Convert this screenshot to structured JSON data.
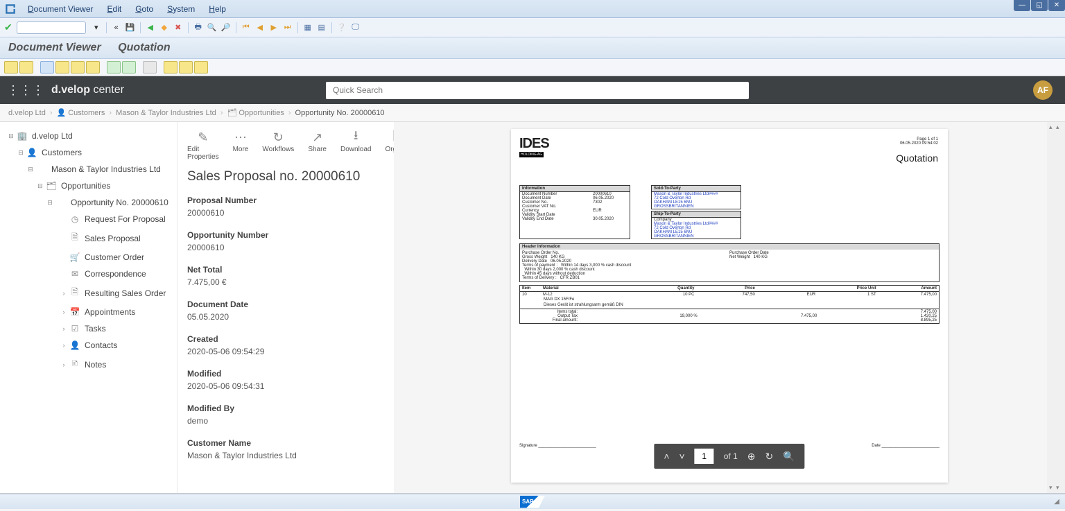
{
  "sap_menu": {
    "items": [
      "Document Viewer",
      "Edit",
      "Goto",
      "System",
      "Help"
    ]
  },
  "title_bar": {
    "left": "Document Viewer",
    "right": "Quotation"
  },
  "dvelop": {
    "brand_prefix": "d.velop",
    "brand_suffix": " center",
    "search_placeholder": "Quick Search",
    "avatar": "AF",
    "grid_apps": "apps"
  },
  "breadcrumb": [
    {
      "label": "d.velop Ltd",
      "icon": ""
    },
    {
      "label": "Customers",
      "icon": "👤"
    },
    {
      "label": "Mason & Taylor Industries Ltd",
      "icon": ""
    },
    {
      "label": "Opportunities",
      "icon": "🗂"
    },
    {
      "label": "Opportunity No. 20000610",
      "icon": ""
    }
  ],
  "tree": [
    {
      "level": 0,
      "label": "d.velop Ltd",
      "expander": "⊟",
      "icon": "building"
    },
    {
      "level": 1,
      "label": "Customers",
      "expander": "⊟",
      "icon": "person"
    },
    {
      "level": 2,
      "label": "Mason & Taylor Industries Ltd",
      "expander": "⊟",
      "icon": ""
    },
    {
      "level": 3,
      "label": "Opportunities",
      "expander": "⊟",
      "icon": "folder"
    },
    {
      "level": 4,
      "label": "Opportunity No. 20000610",
      "expander": "⊟",
      "icon": ""
    },
    {
      "level": 5,
      "label": "Request For Proposal",
      "expander": "",
      "icon": "clock"
    },
    {
      "level": 5,
      "label": "Sales Proposal",
      "expander": "",
      "icon": "doc"
    },
    {
      "level": 5,
      "label": "Customer Order",
      "expander": "",
      "icon": "cart"
    },
    {
      "level": 5,
      "label": "Correspondence",
      "expander": "",
      "icon": "mail"
    },
    {
      "level": 5,
      "label": "Resulting Sales Order",
      "expander": "›",
      "icon": "doc"
    },
    {
      "level": 5,
      "label": "Appointments",
      "expander": "›",
      "icon": "calendar"
    },
    {
      "level": 5,
      "label": "Tasks",
      "expander": "›",
      "icon": "check"
    },
    {
      "level": 5,
      "label": "Contacts",
      "expander": "›",
      "icon": "person"
    },
    {
      "level": 5,
      "label": "Notes",
      "expander": "›",
      "icon": "note"
    }
  ],
  "tools": [
    {
      "label": "Edit Properties",
      "icon": "✎"
    },
    {
      "label": "More",
      "icon": "⋯"
    },
    {
      "label": "Workflows",
      "icon": "↻"
    },
    {
      "label": "Share",
      "icon": "↗"
    },
    {
      "label": "Download",
      "icon": "⭳"
    },
    {
      "label": "Organize",
      "icon": "🗐"
    }
  ],
  "page_title": "Sales Proposal no. 20000610",
  "fields": [
    {
      "label": "Proposal Number",
      "value": "20000610"
    },
    {
      "label": "Opportunity Number",
      "value": "20000610"
    },
    {
      "label": "Net Total",
      "value": "7.475,00 €"
    },
    {
      "label": "Document Date",
      "value": "05.05.2020"
    },
    {
      "label": "Created",
      "value": "2020-05-06 09:54:29"
    },
    {
      "label": "Modified",
      "value": "2020-05-06 09:54:31"
    },
    {
      "label": "Modified By",
      "value": "demo"
    },
    {
      "label": "Customer Name",
      "value": "Mason & Taylor Industries Ltd"
    }
  ],
  "doc": {
    "logo": "IDES",
    "logo_sub": "HOLDING AG",
    "page": "Page 1 of 1",
    "gentime": "06.05.2020 09:54:02",
    "heading": "Quotation",
    "info": {
      "head": "Information",
      "rows": [
        [
          "Document Number",
          "20000610"
        ],
        [
          "Document Date",
          "06.05.2020"
        ],
        [
          "Customer No.",
          "7302"
        ],
        [
          "Customer VAT No.",
          ""
        ],
        [
          "Currency",
          "EUR"
        ],
        [
          "Validity Start Date",
          ""
        ],
        [
          "Validity End Date",
          "30.05.2020"
        ]
      ]
    },
    "soldto": {
      "head": "Sold-To-Party",
      "rows": [
        "Mason & Taylor Industries Ltd####",
        "72 Cold Overton Rd",
        "OAKHAM LE15 6NU",
        "GROSSBRITANNIEN"
      ]
    },
    "shipto": {
      "head": "Ship-To-Party",
      "rows": [
        "Company",
        "Mason & Taylor Industries Ltd####",
        "72 Cold Overton Rd",
        "OAKHAM LE15 6NU",
        "GROSSBRITANNIEN"
      ]
    },
    "header": {
      "head": "Header Information",
      "rows": [
        [
          "Purchase Order No.",
          ""
        ],
        [
          "Purchase Order Date",
          ""
        ],
        [
          "Gross Weight",
          "140  KG"
        ],
        [
          "Net Weight",
          "140  KG"
        ],
        [
          "Delivery Date",
          "06.05.2020"
        ],
        [
          "",
          ""
        ],
        [
          "Terms of payment :",
          "Within 14 days 3,000  % cash discount"
        ],
        [
          "",
          ""
        ],
        [
          "",
          "Within 30 days 2,000  % cash discount"
        ],
        [
          "",
          ""
        ],
        [
          "",
          "Within 45 days without deduction"
        ],
        [
          "",
          ""
        ],
        [
          "Terms of Delivery :",
          "CFR ZB01"
        ],
        [
          "",
          ""
        ]
      ]
    },
    "items_head": [
      "Item",
      "Material",
      "Quantity",
      "Price",
      "",
      "Price Unit",
      "Amount"
    ],
    "items": [
      [
        "10",
        "M-12",
        "10  PC",
        "747,50",
        "EUR",
        "1     ST",
        "7.475,00"
      ]
    ],
    "items_sub": [
      "MAG DX 15F/Fe",
      "Dieses Gerät ist strahlungsarm gemäß DIN"
    ],
    "totals": [
      [
        "Items total:",
        "",
        "",
        "7.475,00"
      ],
      [
        "Output Tax",
        "19,000       %",
        "7.475,00",
        "1.420,25"
      ],
      [
        "Final amount:",
        "",
        "",
        "8.895,25"
      ]
    ],
    "sig_left": "Signature",
    "sig_right": "Date"
  },
  "pdf_nav": {
    "page": "1",
    "of": "of 1"
  },
  "footer": {
    "sap": "SAP"
  }
}
